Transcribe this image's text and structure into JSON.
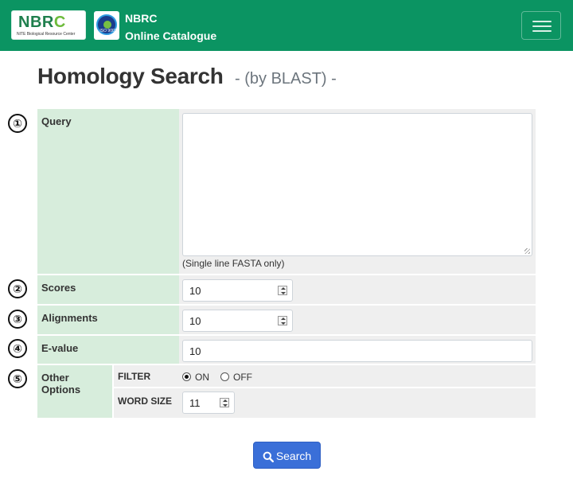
{
  "header": {
    "logo_text": "NBRC",
    "logo_subtext": "NITE Biological Resource Center",
    "iso_text": "ISO 9001",
    "brand_line1": "NBRC",
    "brand_line2": "Online Catalogue",
    "menu_icon": "hamburger-menu-icon",
    "color": "#0b9462"
  },
  "page": {
    "title": "Homology Search",
    "subtitle": "- (by BLAST) -"
  },
  "markers": [
    "①",
    "②",
    "③",
    "④",
    "⑤"
  ],
  "form": {
    "query_label": "Query",
    "query_value": "",
    "query_hint": "(Single line FASTA only)",
    "scores_label": "Scores",
    "scores_value": "10",
    "alignments_label": "Alignments",
    "alignments_value": "10",
    "evalue_label": "E-value",
    "evalue_value": "10",
    "other_label": "Other Options",
    "filter_label": "FILTER",
    "filter_on": "ON",
    "filter_off": "OFF",
    "filter_selected": "ON",
    "wordsize_label": "WORD SIZE",
    "wordsize_value": "11"
  },
  "search_button": {
    "label": "Search",
    "icon": "search-icon",
    "color": "#3a6fd8"
  }
}
